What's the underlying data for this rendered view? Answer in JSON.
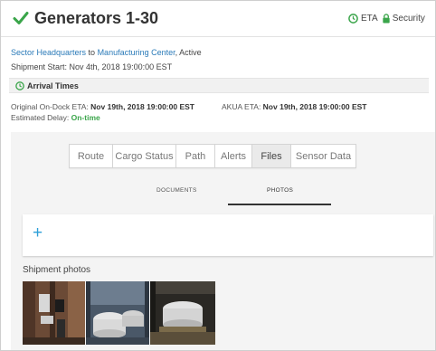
{
  "header": {
    "title": "Generators 1-30",
    "eta_label": "ETA",
    "security_label": "Security"
  },
  "route": {
    "origin": "Sector Headquarters",
    "connector": " to ",
    "destination": "Manufacturing Center",
    "status": ", Active"
  },
  "shipment_start": "Shipment Start: Nov 4th, 2018 19:00:00 EST",
  "arrival": {
    "title": "Arrival Times",
    "original_label": "Original On-Dock ETA: ",
    "original_value": "Nov 19th, 2018 19:00:00 EST",
    "akua_label": "AKUA ETA: ",
    "akua_value": "Nov 19th, 2018 19:00:00 EST",
    "delay_label": "Estimated Delay: ",
    "delay_value": "On-time"
  },
  "tabs": [
    "Route",
    "Cargo Status",
    "Path",
    "Alerts",
    "Files",
    "Sensor Data"
  ],
  "active_tab": "Files",
  "subtabs": [
    "DOCUMENTS",
    "PHOTOS"
  ],
  "active_subtab": "PHOTOS",
  "add_symbol": "+",
  "photos_label": "Shipment photos",
  "colors": {
    "accent_green": "#3aa54a",
    "link_blue": "#2a7ab8",
    "plus_blue": "#2e9fd8"
  },
  "icons": [
    "check-icon",
    "clock-icon",
    "lock-icon",
    "plus-icon"
  ]
}
